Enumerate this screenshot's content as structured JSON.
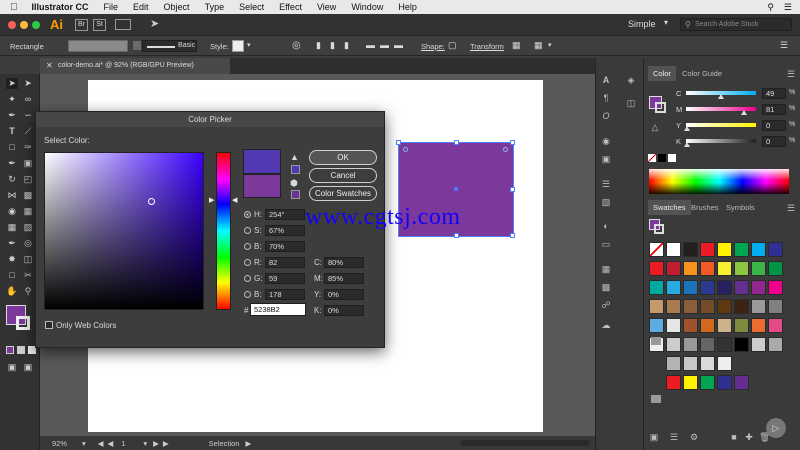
{
  "menubar": {
    "app_name": "Illustrator CC",
    "items": [
      "File",
      "Edit",
      "Object",
      "Type",
      "Select",
      "Effect",
      "View",
      "Window",
      "Help"
    ]
  },
  "appbar": {
    "logo": "Ai",
    "br": "Br",
    "st": "St",
    "workspace": "Simple",
    "search_placeholder": "Search Adobe Stock"
  },
  "control_bar": {
    "selection_type": "Rectangle",
    "stroke_style": "Basic",
    "style_label": "Style:",
    "shape_label": "Shape:",
    "transform_label": "Transform"
  },
  "document_tab": {
    "title": "color-demo.ai* @ 92% (RGB/GPU Preview)"
  },
  "status_bar": {
    "zoom": "92%",
    "artboard": "1",
    "tool": "Selection"
  },
  "color_panel": {
    "tabs": [
      "Color",
      "Color Guide"
    ],
    "rows": [
      {
        "label": "C",
        "value": "49",
        "color": "#00aeef",
        "pos": 0.49
      },
      {
        "label": "M",
        "value": "81",
        "color": "#ec008c",
        "pos": 0.81
      },
      {
        "label": "Y",
        "value": "0",
        "color": "#fff200",
        "pos": 0.0
      },
      {
        "label": "K",
        "value": "0",
        "color": "#231f20",
        "pos": 0.0
      }
    ]
  },
  "swatches_panel": {
    "tabs": [
      "Swatches",
      "Brushes",
      "Symbols"
    ],
    "rows": [
      [
        "#ffffff",
        "#ffffff",
        "#231f20",
        "#ed1c24",
        "#fff200",
        "#00a651",
        "#00aeef",
        "#2e3192"
      ],
      [
        "#ed1c24",
        "#be1e2d",
        "#f7941d",
        "#f15a24",
        "#f9ed32",
        "#8dc63f",
        "#39b54a",
        "#009444"
      ],
      [
        "#00a99d",
        "#27aae1",
        "#1c75bc",
        "#2b3990",
        "#262262",
        "#662d91",
        "#92278f",
        "#ec008c"
      ],
      [
        "#c49a6c",
        "#a97c50",
        "#8b5e3c",
        "#754c29",
        "#603913",
        "#3c2415",
        "#999999",
        "#808080"
      ],
      [
        "#5dade2",
        "#e6e6e6",
        "#a0522d",
        "#d2691e",
        "#cdb38b",
        "#808a3f",
        "#ec6b30",
        "#e24a8a"
      ],
      [
        "#eeeeee",
        "#cccccc",
        "#999999",
        "#666666",
        "#333333",
        "#000000",
        "#cccccc",
        "#aaaaaa"
      ],
      [
        "#b3b3b3",
        "#c7c7c7",
        "#d9d9d9",
        "#eeeeee"
      ],
      [
        "#ed1c24",
        "#fff200",
        "#00a651",
        "#2e3192",
        "#662d91"
      ]
    ]
  },
  "dialog": {
    "title": "Color Picker",
    "select_label": "Select Color:",
    "ok_label": "OK",
    "cancel_label": "Cancel",
    "swatches_label": "Color Swatches",
    "only_web_label": "Only Web Colors",
    "new_color": "#5238b2",
    "old_color": "#7b3a9b",
    "fields": {
      "H": {
        "label": "H:",
        "value": "254°"
      },
      "S": {
        "label": "S:",
        "value": "67%"
      },
      "Bv": {
        "label": "B:",
        "value": "70%"
      },
      "R": {
        "label": "R:",
        "value": "82"
      },
      "G": {
        "label": "G:",
        "value": "59"
      },
      "Bb": {
        "label": "B:",
        "value": "178"
      },
      "C": {
        "label": "C:",
        "value": "80%"
      },
      "M": {
        "label": "M:",
        "value": "85%"
      },
      "Y": {
        "label": "Y:",
        "value": "0%"
      },
      "K": {
        "label": "K:",
        "value": "0%"
      },
      "hex": {
        "label": "#",
        "value": "5238B2"
      }
    },
    "hue": 254
  },
  "canvas": {
    "rect_color": "#7b3a9b"
  },
  "watermark": "www.cgtsj.com"
}
